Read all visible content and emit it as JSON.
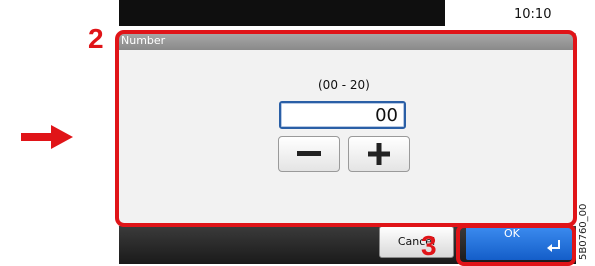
{
  "status": {
    "time": "10:10"
  },
  "screen": {
    "title": "Number",
    "range_label": "(00 - 20)",
    "value": "00"
  },
  "buttons": {
    "cancel": "Cancel",
    "ok": "OK"
  },
  "callouts": {
    "step2": "2",
    "step3": "3"
  },
  "figure_code": "5B0760_00",
  "icons": {
    "minus": "minus-icon",
    "plus": "plus-icon",
    "enter": "enter-icon",
    "arrow": "arrow-right-icon"
  },
  "colors": {
    "highlight": "#e01418",
    "accent": "#1f6fdc",
    "titlebar": "#9a9a9a"
  }
}
